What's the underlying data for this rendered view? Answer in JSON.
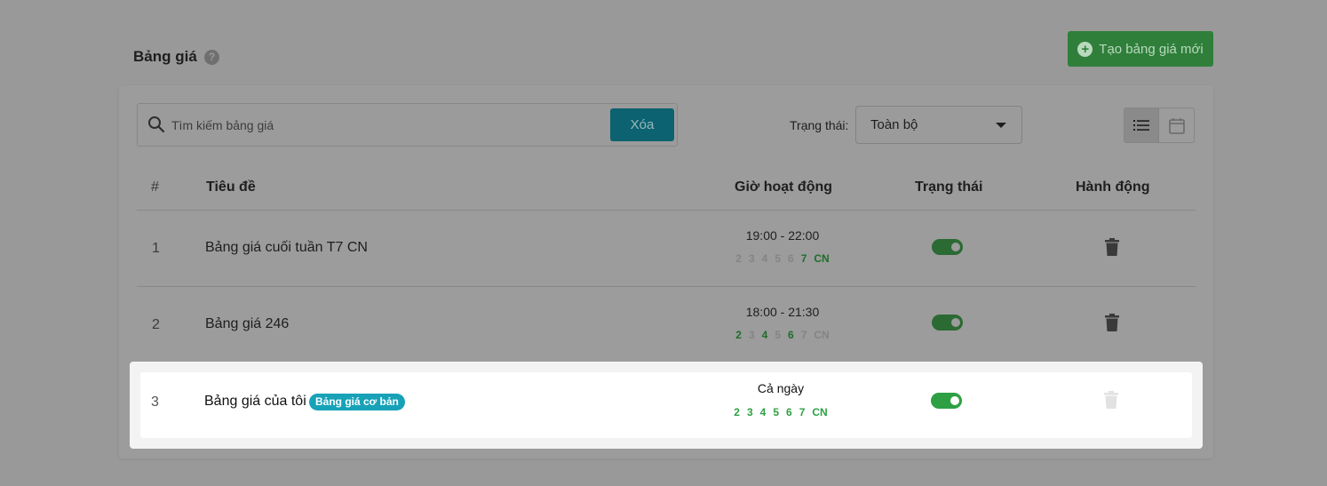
{
  "header": {
    "title": "Bảng giá",
    "help_icon": "question-circle-icon",
    "create_button": "Tạo bảng giá mới",
    "create_icon": "plus-circle-icon",
    "accent_color": "#2f7f3b"
  },
  "toolbar": {
    "search_placeholder": "Tìm kiếm bảng giá",
    "search_value": "",
    "clear_button": "Xóa",
    "status_label": "Trạng thái:",
    "status_selected": "Toàn bộ",
    "view_modes": [
      "list-view-icon",
      "calendar-view-icon"
    ],
    "active_view": "list"
  },
  "table": {
    "columns": [
      "#",
      "Tiêu đề",
      "Giờ hoạt động",
      "Trạng thái",
      "Hành động"
    ],
    "rows": [
      {
        "index": "1",
        "title": "Bảng giá cuối tuần T7 CN",
        "badge": "",
        "hours": "19:00 - 22:00",
        "days": [
          {
            "label": "2",
            "active": false
          },
          {
            "label": "3",
            "active": false
          },
          {
            "label": "4",
            "active": false
          },
          {
            "label": "5",
            "active": false
          },
          {
            "label": "6",
            "active": false
          },
          {
            "label": "7",
            "active": true
          },
          {
            "label": "CN",
            "active": true
          }
        ],
        "enabled": true,
        "deletable": true
      },
      {
        "index": "2",
        "title": "Bảng giá 246",
        "badge": "",
        "hours": "18:00 - 21:30",
        "days": [
          {
            "label": "2",
            "active": true
          },
          {
            "label": "3",
            "active": false
          },
          {
            "label": "4",
            "active": true
          },
          {
            "label": "5",
            "active": false
          },
          {
            "label": "6",
            "active": true
          },
          {
            "label": "7",
            "active": false
          },
          {
            "label": "CN",
            "active": false
          }
        ],
        "enabled": true,
        "deletable": true
      },
      {
        "index": "3",
        "title": "Bảng giá của tôi",
        "badge": "Bảng giá cơ bản",
        "hours": "Cả ngày",
        "days": [
          {
            "label": "2",
            "active": true
          },
          {
            "label": "3",
            "active": true
          },
          {
            "label": "4",
            "active": true
          },
          {
            "label": "5",
            "active": true
          },
          {
            "label": "6",
            "active": true
          },
          {
            "label": "7",
            "active": true
          },
          {
            "label": "CN",
            "active": true
          }
        ],
        "enabled": true,
        "deletable": false
      }
    ]
  },
  "colors": {
    "active_green": "#2ea043",
    "badge_teal": "#17a2b8",
    "clear_button": "#0c6270"
  }
}
